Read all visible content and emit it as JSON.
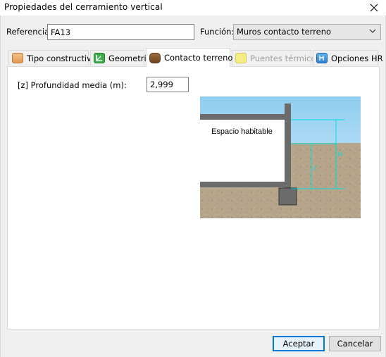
{
  "window": {
    "title": "Propiedades del cerramiento vertical"
  },
  "form": {
    "referencia_label": "Referencia:",
    "referencia_value": "FA13",
    "funcion_label": "Función:",
    "funcion_value": "Muros contacto terreno"
  },
  "tabs": [
    {
      "label": "Tipo constructivo",
      "icon": "construction-type-icon",
      "state": "normal"
    },
    {
      "label": "Geometría",
      "icon": "geometry-icon",
      "state": "normal"
    },
    {
      "label": "Contacto terreno",
      "icon": "ground-contact-icon",
      "state": "active"
    },
    {
      "label": "Puentes térmicos",
      "icon": "thermal-bridge-icon",
      "state": "disabled"
    },
    {
      "label": "Opciones HR",
      "icon": "hr-options-icon",
      "state": "normal"
    }
  ],
  "panel": {
    "depth_label": "[z] Profundidad media (m):",
    "depth_value": "2,999",
    "diagram": {
      "space_label": "Espacio habitable",
      "z_label": "z",
      "h_label": "H"
    }
  },
  "buttons": {
    "accept": "Aceptar",
    "cancel": "Cancelar"
  },
  "colors": {
    "accent": "#0078d7",
    "sky": "#bde2f6",
    "soil": "#b9a88f",
    "dimension": "#00e0e0"
  }
}
